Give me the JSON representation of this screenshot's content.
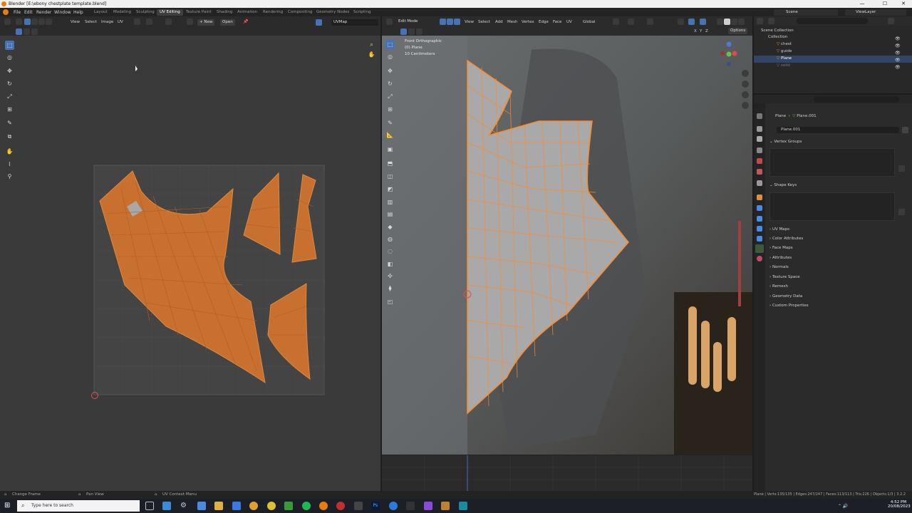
{
  "window": {
    "title": "Blender [E:\\ebony chestplate template.blend]",
    "minimize": "—",
    "maximize": "☐",
    "close": "✕"
  },
  "menu": [
    "File",
    "Edit",
    "Render",
    "Window",
    "Help"
  ],
  "workspaces": [
    "Layout",
    "Modeling",
    "Sculpting",
    "UV Editing",
    "Texture Paint",
    "Shading",
    "Animation",
    "Rendering",
    "Compositing",
    "Geometry Nodes",
    "Scripting"
  ],
  "active_workspace": "UV Editing",
  "scene": {
    "scene_label": "Scene",
    "view_layer_label": "ViewLayer"
  },
  "uv_editor": {
    "menus": [
      "View",
      "Select",
      "Image",
      "UV"
    ],
    "new_label": "New",
    "open_label": "Open",
    "uvmap_label": "UVMap"
  },
  "viewport": {
    "mode_label": "Edit Mode",
    "menus": [
      "View",
      "Select",
      "Add",
      "Mesh",
      "Vertex",
      "Edge",
      "Face",
      "UV"
    ],
    "orientation": "Global",
    "options_label": "Options",
    "axes": [
      "X",
      "Y",
      "Z"
    ],
    "overlay": {
      "view": "Front Orthographic",
      "object": "(0) Plane",
      "scale": "10 Centimeters"
    }
  },
  "outliner": {
    "root": "Scene Collection",
    "collection": "Collection",
    "items": [
      "chest",
      "guide",
      "Plane",
      "solid"
    ]
  },
  "properties": {
    "object": "Plane",
    "mesh": "Plane.001",
    "data_name": "Plane.001",
    "panels_open": [
      "Vertex Groups",
      "Shape Keys"
    ],
    "panels_closed": [
      "UV Maps",
      "Color Attributes",
      "Face Maps",
      "Attributes",
      "Normals",
      "Texture Space",
      "Remesh",
      "Geometry Data",
      "Custom Properties"
    ]
  },
  "statusbar": {
    "left": "Change Frame",
    "mid": "Pan View",
    "right": "UV Context Menu",
    "stats": "Plane | Verts:135/135 | Edges:247/247 | Faces:113/113 | Tris:226 | Objects:1/3 | 3.2.2"
  },
  "taskbar": {
    "search_placeholder": "Type here to search",
    "time": "4:52 PM",
    "date": "20/08/2023"
  },
  "colors": {
    "accent": "#4772b3",
    "uv_orange": "#c8702f",
    "edge_orange": "#ff8a2a"
  }
}
